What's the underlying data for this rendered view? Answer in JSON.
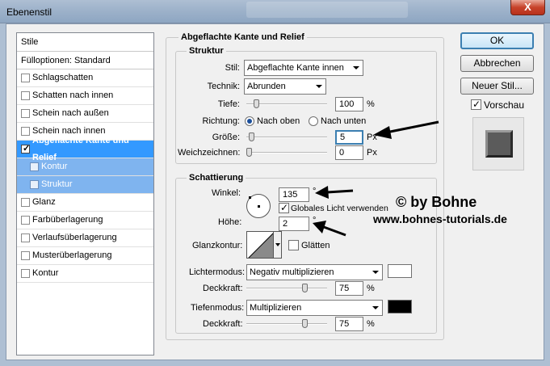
{
  "window": {
    "title": "Ebenenstil",
    "close_label": "X"
  },
  "style_list": {
    "header": "Stile",
    "fill_options": "Fülloptionen: Standard",
    "items": [
      {
        "label": "Schlagschatten",
        "checked": false
      },
      {
        "label": "Schatten nach innen",
        "checked": false
      },
      {
        "label": "Schein nach außen",
        "checked": false
      },
      {
        "label": "Schein nach innen",
        "checked": false
      },
      {
        "label": "Abgeflachte Kante und Relief",
        "checked": true
      },
      {
        "label": "Kontur",
        "checked": false
      },
      {
        "label": "Struktur",
        "checked": false
      },
      {
        "label": "Glanz",
        "checked": false
      },
      {
        "label": "Farbüberlagerung",
        "checked": false
      },
      {
        "label": "Verlaufsüberlagerung",
        "checked": false
      },
      {
        "label": "Musterüberlagerung",
        "checked": false
      },
      {
        "label": "Kontur",
        "checked": false
      }
    ]
  },
  "main": {
    "group_title": "Abgeflachte Kante und Relief",
    "structure": {
      "title": "Struktur",
      "style_label": "Stil:",
      "style_value": "Abgeflachte Kante innen",
      "technique_label": "Technik:",
      "technique_value": "Abrunden",
      "depth_label": "Tiefe:",
      "depth_value": "100",
      "depth_unit": "%",
      "depth_slider": 0.1,
      "direction_label": "Richtung:",
      "direction_up": "Nach oben",
      "direction_down": "Nach unten",
      "size_label": "Größe:",
      "size_value": "5",
      "size_unit": "Px",
      "size_slider": 0.03,
      "soften_label": "Weichzeichnen:",
      "soften_value": "0",
      "soften_unit": "Px",
      "soften_slider": 0.0
    },
    "shading": {
      "title": "Schattierung",
      "angle_label": "Winkel:",
      "angle_value": "135",
      "degree": "°",
      "global_light_label": "Globales Licht verwenden",
      "altitude_label": "Höhe:",
      "altitude_value": "2",
      "gloss_contour_label": "Glanzkontur:",
      "anti_aliased_label": "Glätten",
      "highlight_mode_label": "Lichtermodus:",
      "highlight_mode_value": "Negativ multiplizieren",
      "highlight_color": "#ffffff",
      "highlight_opacity_label": "Deckkraft:",
      "highlight_opacity_value": "75",
      "highlight_opacity_slider": 0.75,
      "shadow_mode_label": "Tiefenmodus:",
      "shadow_mode_value": "Multiplizieren",
      "shadow_color": "#000000",
      "shadow_opacity_label": "Deckkraft:",
      "shadow_opacity_value": "75",
      "shadow_opacity_slider": 0.75,
      "percent": "%"
    }
  },
  "buttons": {
    "ok": "OK",
    "cancel": "Abbrechen",
    "new_style": "Neuer Stil...",
    "preview_label": "Vorschau"
  },
  "watermark": {
    "line1": "© by Bohne",
    "line2": "www.bohnes-tutorials.de"
  }
}
